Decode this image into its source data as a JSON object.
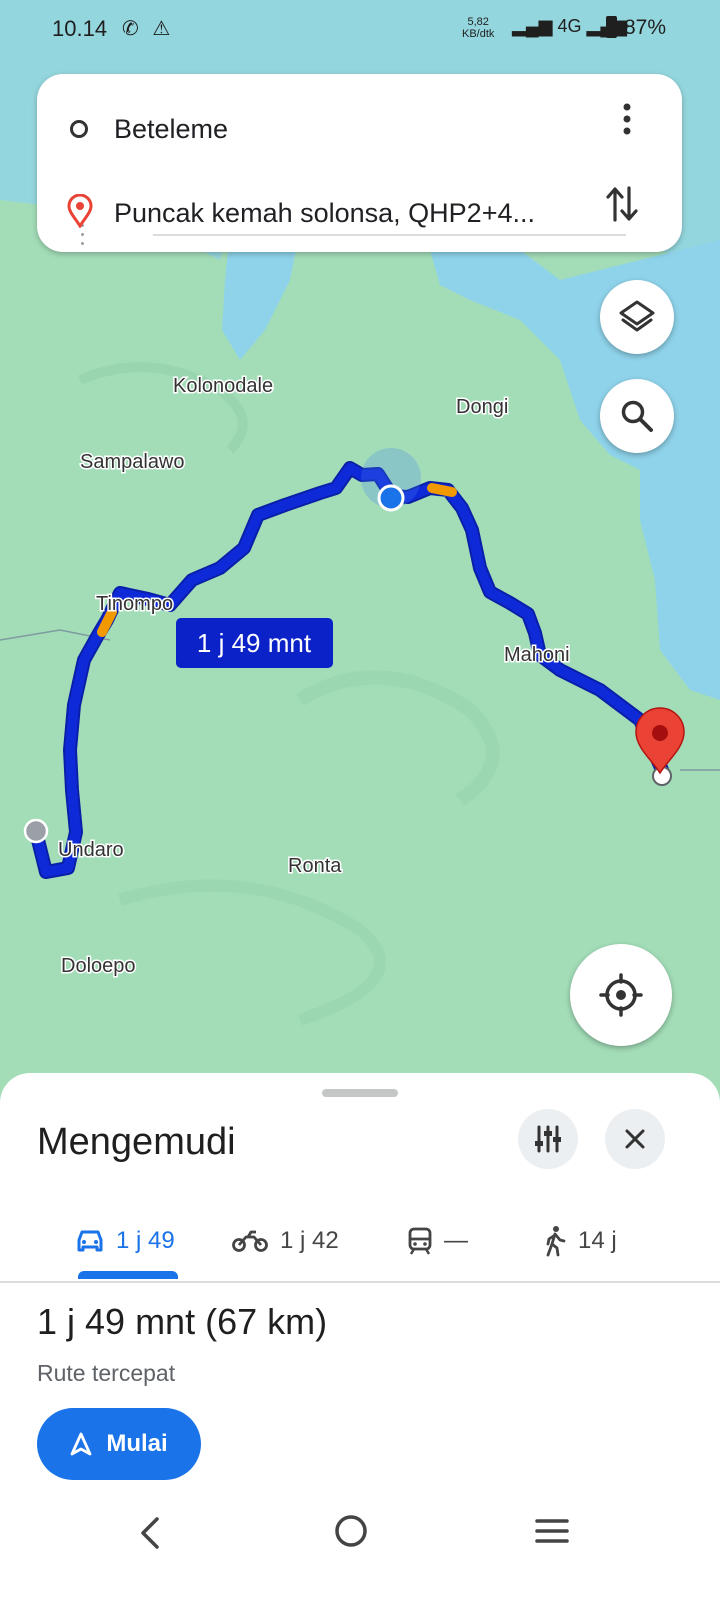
{
  "status_bar": {
    "time": "10.14",
    "notification_icons": [
      "whatsapp-icon",
      "warning-icon"
    ],
    "network_speed": "5,82",
    "network_speed_unit": "KB/dtk",
    "network_type": "4G",
    "battery": "87%"
  },
  "directions": {
    "origin": "Beteleme",
    "destination": "Puncak kemah solonsa, QHP2+4..."
  },
  "map": {
    "places": [
      "Kolonodale",
      "Dongi",
      "Sampalawo",
      "Tinompo",
      "Mahoni",
      "Undaro",
      "Ronta",
      "Doloepo"
    ],
    "route_label": "1 j 49 mnt",
    "colors": {
      "route": "#0e2ad8",
      "label_bg": "#0b22c8",
      "water": "#8fd3ea",
      "land": "#a3ddb8",
      "destination_pin": "#ea4335"
    }
  },
  "sheet": {
    "title": "Mengemudi",
    "tabs": [
      {
        "icon": "car-icon",
        "label": "1 j 49"
      },
      {
        "icon": "motorcycle-icon",
        "label": "1 j 42"
      },
      {
        "icon": "train-icon",
        "label": "—"
      },
      {
        "icon": "walking-icon",
        "label": "14 j"
      }
    ],
    "active_tab": "car",
    "duration": "1 j 49 mnt",
    "distance": "(67 km)",
    "route_description": "Rute tercepat",
    "start_label": "Mulai"
  }
}
